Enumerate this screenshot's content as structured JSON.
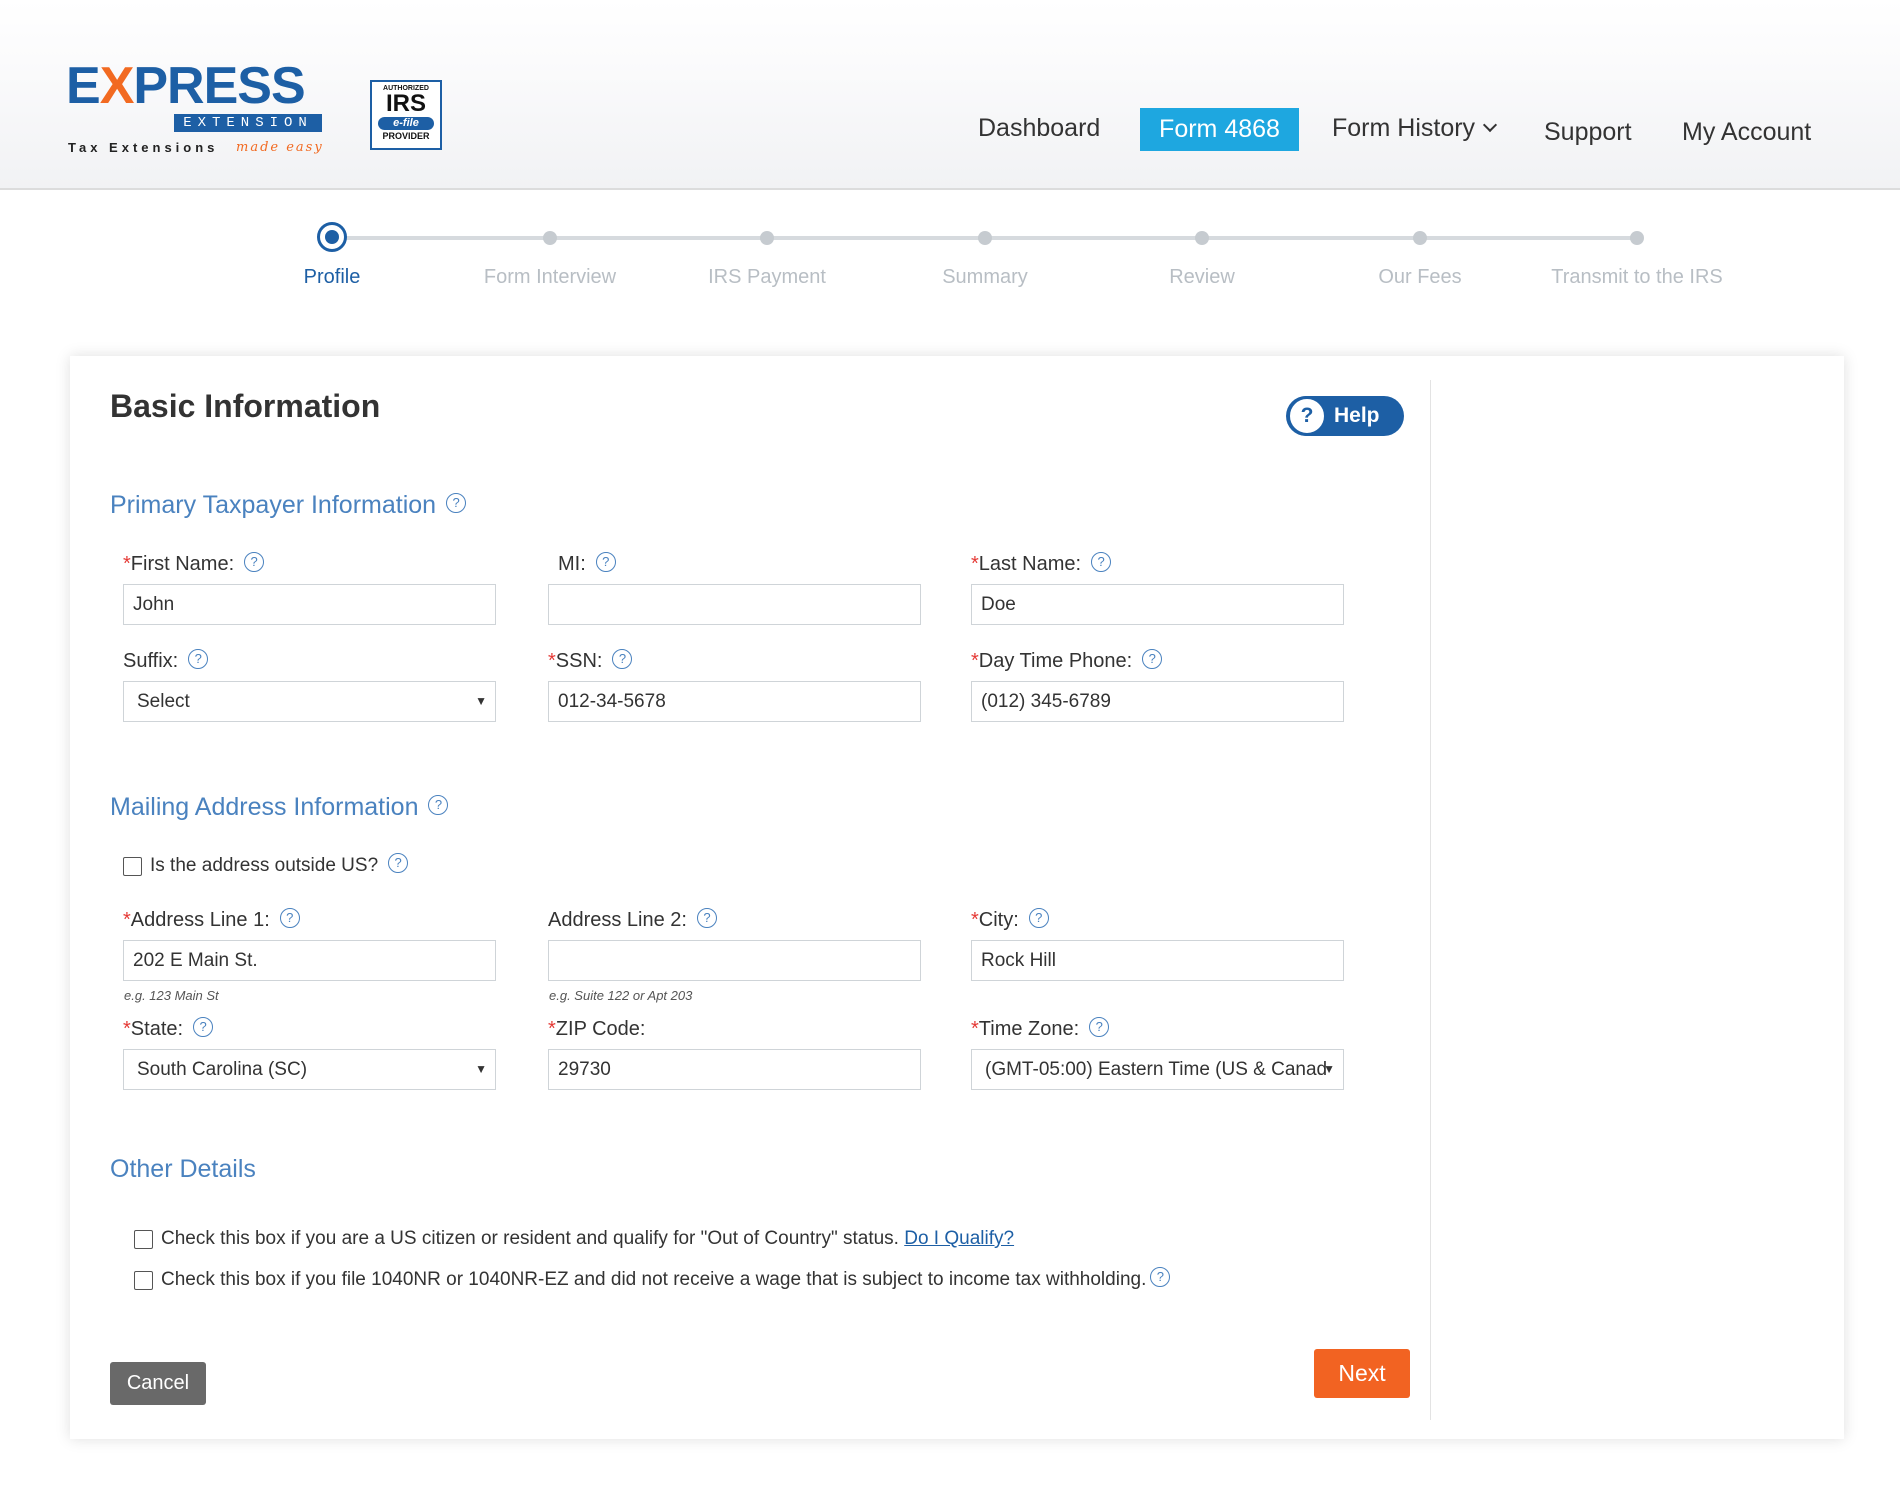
{
  "header": {
    "logo": {
      "word_prefix": "E",
      "word_x": "X",
      "word_rest": "PRESS",
      "sub": "EXTENSION",
      "tagline": "Tax Extensions",
      "tagline_em": "made easy"
    },
    "irs_badge": {
      "top": "AUTHORIZED",
      "big": "IRS",
      "efile": "e-file",
      "bottom": "PROVIDER"
    },
    "nav": {
      "dashboard": "Dashboard",
      "form": "Form 4868",
      "history": "Form History",
      "support": "Support",
      "account": "My Account"
    }
  },
  "stepper": {
    "steps": [
      "Profile",
      "Form Interview",
      "IRS Payment",
      "Summary",
      "Review",
      "Our Fees",
      "Transmit to the IRS"
    ],
    "active_index": 0
  },
  "card": {
    "title": "Basic Information",
    "help_label": "Help",
    "help_q": "?"
  },
  "primary": {
    "heading": "Primary Taxpayer Information",
    "first_name": {
      "label": "First Name:",
      "value": "John"
    },
    "mi": {
      "label": "MI:",
      "value": ""
    },
    "last_name": {
      "label": "Last Name:",
      "value": "Doe"
    },
    "suffix": {
      "label": "Suffix:",
      "value": "Select"
    },
    "ssn": {
      "label": "SSN:",
      "value": "012-34-5678"
    },
    "phone": {
      "label": "Day Time Phone:",
      "value": "(012) 345-6789"
    }
  },
  "mailing": {
    "heading": "Mailing Address Information",
    "outside_us": "Is the address outside US?",
    "address1": {
      "label": "Address Line 1:",
      "value": "202 E Main St.",
      "hint": "e.g. 123 Main St"
    },
    "address2": {
      "label": "Address Line 2:",
      "value": "",
      "hint": "e.g. Suite 122 or Apt 203"
    },
    "city": {
      "label": "City:",
      "value": "Rock Hill"
    },
    "state": {
      "label": "State:",
      "value": "South Carolina (SC)"
    },
    "zip": {
      "label": "ZIP Code:",
      "value": "29730"
    },
    "timezone": {
      "label": "Time Zone:",
      "value": "(GMT-05:00) Eastern Time (US & Canad"
    }
  },
  "other": {
    "heading": "Other Details",
    "check1": "Check this box if you are a US citizen or resident and qualify for \"Out of Country\" status.",
    "check1_link": "Do I Qualify?",
    "check2": "Check this box if you file 1040NR or 1040NR-EZ and did not receive a wage that is subject to income tax withholding."
  },
  "actions": {
    "cancel": "Cancel",
    "next": "Next"
  },
  "colors": {
    "brand_blue": "#1d5fa5",
    "nav_active": "#1ea7e0",
    "section_blue": "#4a82bf",
    "next_orange": "#f26322",
    "cancel_gray": "#696969",
    "required_red": "#e53935"
  },
  "icons": [
    "help-circle-icon",
    "chevron-down-icon",
    "select-arrow-icon"
  ]
}
